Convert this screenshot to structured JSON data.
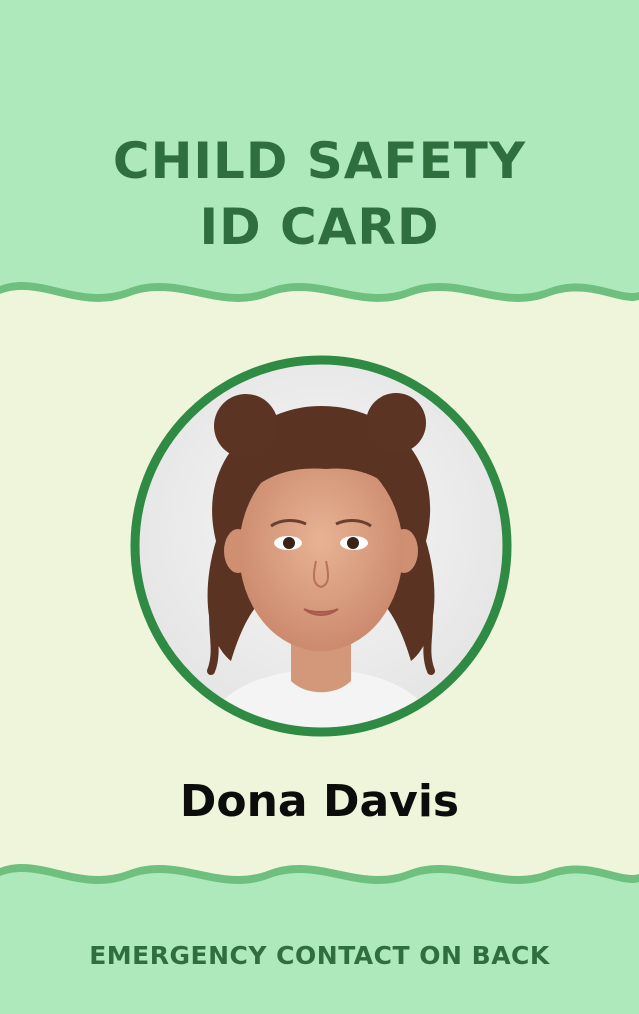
{
  "card": {
    "title_line1": "CHILD SAFETY",
    "title_line2": "ID CARD",
    "child_name": "Dona Davis",
    "footer_text": "EMERGENCY CONTACT ON BACK"
  },
  "colors": {
    "band_green": "#aee9bb",
    "wave_green": "#6fc07f",
    "background_cream": "#eff5db",
    "title_green": "#2f6e3d",
    "photo_ring_green": "#2f8a43",
    "name_black": "#0c0c0c"
  },
  "icons": {
    "photo": "child-portrait"
  }
}
